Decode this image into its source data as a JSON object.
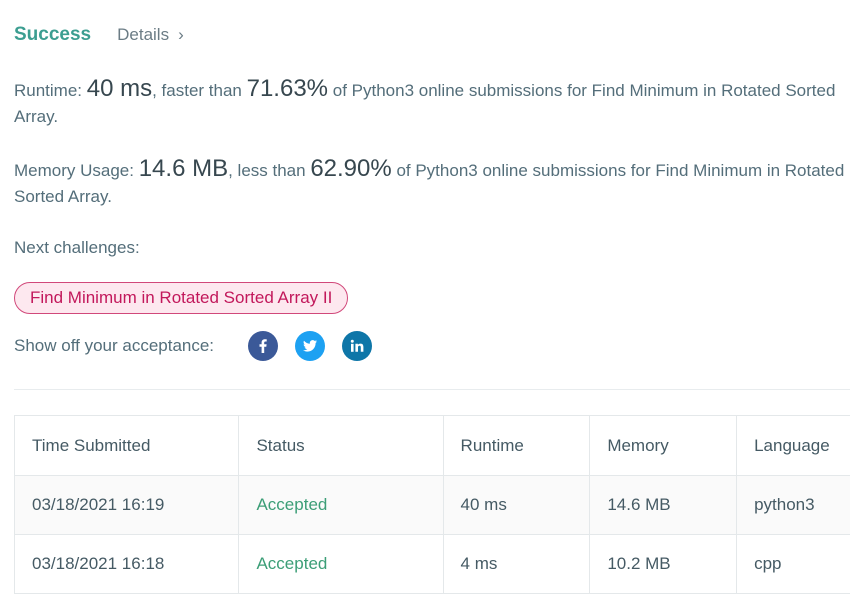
{
  "header": {
    "status": "Success",
    "details_label": "Details",
    "details_chevron": "›"
  },
  "runtime": {
    "label": "Runtime: ",
    "value": "40 ms",
    "mid_text": ", faster than ",
    "percent": "71.63%",
    "tail_text": " of Python3 online submissions for Find Minimum in Rotated Sorted Array."
  },
  "memory": {
    "label": "Memory Usage: ",
    "value": "14.6 MB",
    "mid_text": ", less than ",
    "percent": "62.90%",
    "tail_text": " of Python3 online submissions for Find Minimum in Rotated Sorted Array."
  },
  "next": {
    "label": "Next challenges:",
    "challenge": "Find Minimum in Rotated Sorted Array II"
  },
  "share": {
    "label": "Show off your acceptance:",
    "buttons": [
      {
        "icon": "facebook-icon",
        "glyph": "f",
        "color": "#3b5998"
      },
      {
        "icon": "twitter-icon",
        "glyph": "twitter-bird",
        "color": "#1da1f2"
      },
      {
        "icon": "linkedin-icon",
        "glyph": "in",
        "color": "#0e76a8"
      }
    ]
  },
  "submissions": {
    "columns": [
      "Time Submitted",
      "Status",
      "Runtime",
      "Memory",
      "Language"
    ],
    "rows": [
      {
        "time": "03/18/2021 16:19",
        "status": "Accepted",
        "runtime": "40 ms",
        "memory": "14.6 MB",
        "language": "python3"
      },
      {
        "time": "03/18/2021 16:18",
        "status": "Accepted",
        "runtime": "4 ms",
        "memory": "10.2 MB",
        "language": "cpp"
      }
    ]
  },
  "colors": {
    "success": "#3c9e91",
    "accepted": "#3c9e77",
    "challenge_text": "#c2185b",
    "challenge_bg": "#fde8ef"
  }
}
